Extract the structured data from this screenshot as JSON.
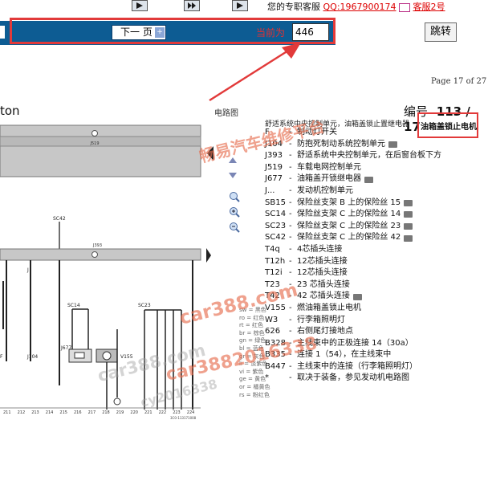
{
  "top": {
    "qq_prefix": "您的专职客服",
    "qq_link": "QQ:1967900174",
    "qq_link2": "客服2号"
  },
  "toolbar": {
    "next_label": "下一 页",
    "current_label": "当前为",
    "page_value": "446",
    "jump_label": "跳转"
  },
  "doc": {
    "page_of": "Page 17 of 27",
    "title_fragment": "ton",
    "diagram_label": "电路图",
    "number_label": "编号",
    "number_value": "113 / 17",
    "header_line": "舒适系统中央控制单元，油箱盖锁止置继电器",
    "boxed_note": "油箱盖锁止电机",
    "legend": [
      {
        "code": "F",
        "desc": "制动灯开关"
      },
      {
        "code": "J104",
        "desc": "防抱死制动系统控制单元"
      },
      {
        "code": "J393",
        "desc": "舒适系统中央控制单元，在后窗台板下方"
      },
      {
        "code": "J519",
        "desc": "车载电网控制单元"
      },
      {
        "code": "J677",
        "desc": "油箱盖开锁继电器"
      },
      {
        "code": "J...",
        "desc": "发动机控制单元"
      },
      {
        "code": "SB15",
        "desc": "保险丝支架 B 上的保险丝 15"
      },
      {
        "code": "SC14",
        "desc": "保险丝支架 C 上的保险丝 14"
      },
      {
        "code": "SC23",
        "desc": "保险丝支架 C 上的保险丝 23"
      },
      {
        "code": "SC42",
        "desc": "保险丝支架 C 上的保险丝 42"
      },
      {
        "code": "T4q",
        "desc": "4芯插头连接"
      },
      {
        "code": "T12h",
        "desc": "12芯插头连接"
      },
      {
        "code": "T12i",
        "desc": "12芯插头连接"
      },
      {
        "code": "T23",
        "desc": "23 芯插头连接"
      },
      {
        "code": "T42",
        "desc": "42 芯插头连接"
      },
      {
        "code": "V155",
        "desc": "燃油箱盖锁止电机"
      },
      {
        "code": "W3",
        "desc": "行李箱照明灯"
      },
      {
        "code": "626",
        "desc": "右侧尾灯接地点"
      },
      {
        "code": "B328",
        "desc": "主线束中的正极连接 14（30a）"
      },
      {
        "code": "B335",
        "desc": "连接 1（54），在主线束中"
      },
      {
        "code": "B447",
        "desc": "主线束中的连接（行李箱照明灯）"
      },
      {
        "code": "*",
        "desc": "取决于装备，参见发动机电路图"
      }
    ],
    "wire_colors": [
      "sw = 黑色",
      "ro = 红色",
      "rt = 红色",
      "br = 棕色",
      "gn = 绿色",
      "bl = 蓝色",
      "gr = 灰色",
      "li = 淡紫色",
      "vi = 紫色",
      "ge = 黄色",
      "or = 橘黄色",
      "rs = 粉红色"
    ],
    "diagram_texts": {
      "bus_j519": "J519",
      "bus_j393": "J393",
      "sc42": "SC42",
      "sc14": "SC14",
      "sc23": "SC23",
      "j104": "J104",
      "j677": "J677",
      "v155": "V155",
      "f": "F",
      "j": "J",
      "ref": "3C0-113171008",
      "bottom_numbers": [
        "211",
        "212",
        "213",
        "214",
        "215",
        "216",
        "217",
        "218",
        "219",
        "220",
        "221",
        "222",
        "223",
        "224"
      ]
    },
    "watermarks": [
      "畅易汽车维修平台",
      "car388.com",
      "car388.com",
      "cy2016338",
      "car3882016338"
    ]
  },
  "colors": {
    "blue_bar": "#0d5c93",
    "red": "#e23a3a"
  }
}
